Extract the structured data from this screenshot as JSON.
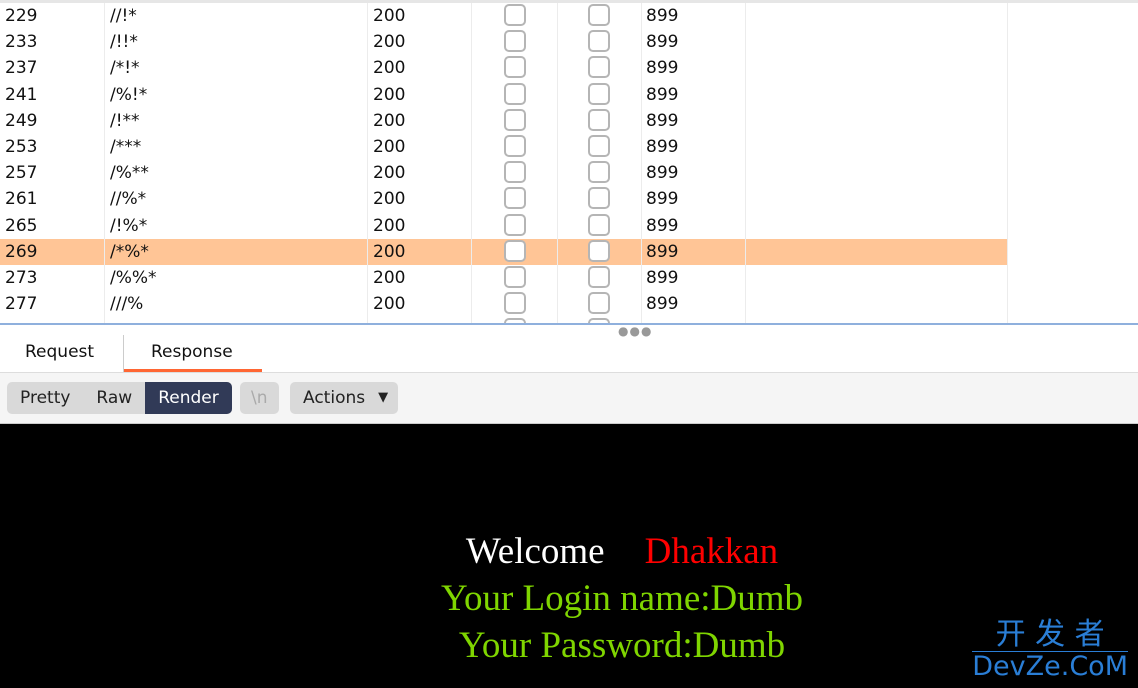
{
  "table": {
    "rows": [
      {
        "id": "229",
        "payload": "//!*",
        "status": "200",
        "length": "899"
      },
      {
        "id": "233",
        "payload": "/!!*",
        "status": "200",
        "length": "899"
      },
      {
        "id": "237",
        "payload": "/*!*",
        "status": "200",
        "length": "899"
      },
      {
        "id": "241",
        "payload": "/%!*",
        "status": "200",
        "length": "899"
      },
      {
        "id": "249",
        "payload": "/!**",
        "status": "200",
        "length": "899"
      },
      {
        "id": "253",
        "payload": "/***",
        "status": "200",
        "length": "899"
      },
      {
        "id": "257",
        "payload": "/%**",
        "status": "200",
        "length": "899"
      },
      {
        "id": "261",
        "payload": "//%*",
        "status": "200",
        "length": "899"
      },
      {
        "id": "265",
        "payload": "/!%*",
        "status": "200",
        "length": "899"
      },
      {
        "id": "269",
        "payload": "/*%*",
        "status": "200",
        "length": "899",
        "selected": true
      },
      {
        "id": "273",
        "payload": "/%%*",
        "status": "200",
        "length": "899"
      },
      {
        "id": "277",
        "payload": "///%",
        "status": "200",
        "length": "899"
      }
    ],
    "selected_color": "#ffc596"
  },
  "tabs": {
    "request": "Request",
    "response": "Response",
    "active": "Response"
  },
  "toolbar": {
    "pretty": "Pretty",
    "raw": "Raw",
    "render": "Render",
    "newline": "\\n",
    "actions": "Actions",
    "active": "Render"
  },
  "render": {
    "welcome": "Welcome",
    "name": "Dhakkan",
    "login": "Your Login name:Dumb",
    "password": "Your Password:Dumb"
  },
  "watermark": {
    "cn": "开 发 者",
    "en": "DevZe.CoM"
  }
}
